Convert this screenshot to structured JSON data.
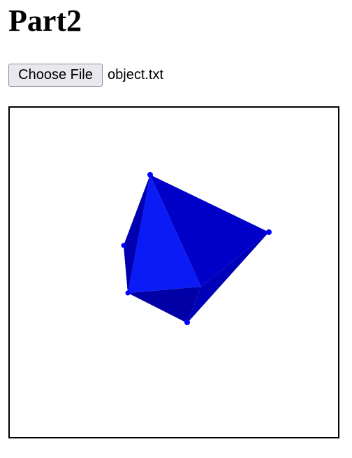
{
  "page": {
    "title": "Part2"
  },
  "file_input": {
    "button_label": "Choose File",
    "selected_file": "object.txt"
  },
  "viewer": {
    "object_color": "#0000ff"
  }
}
